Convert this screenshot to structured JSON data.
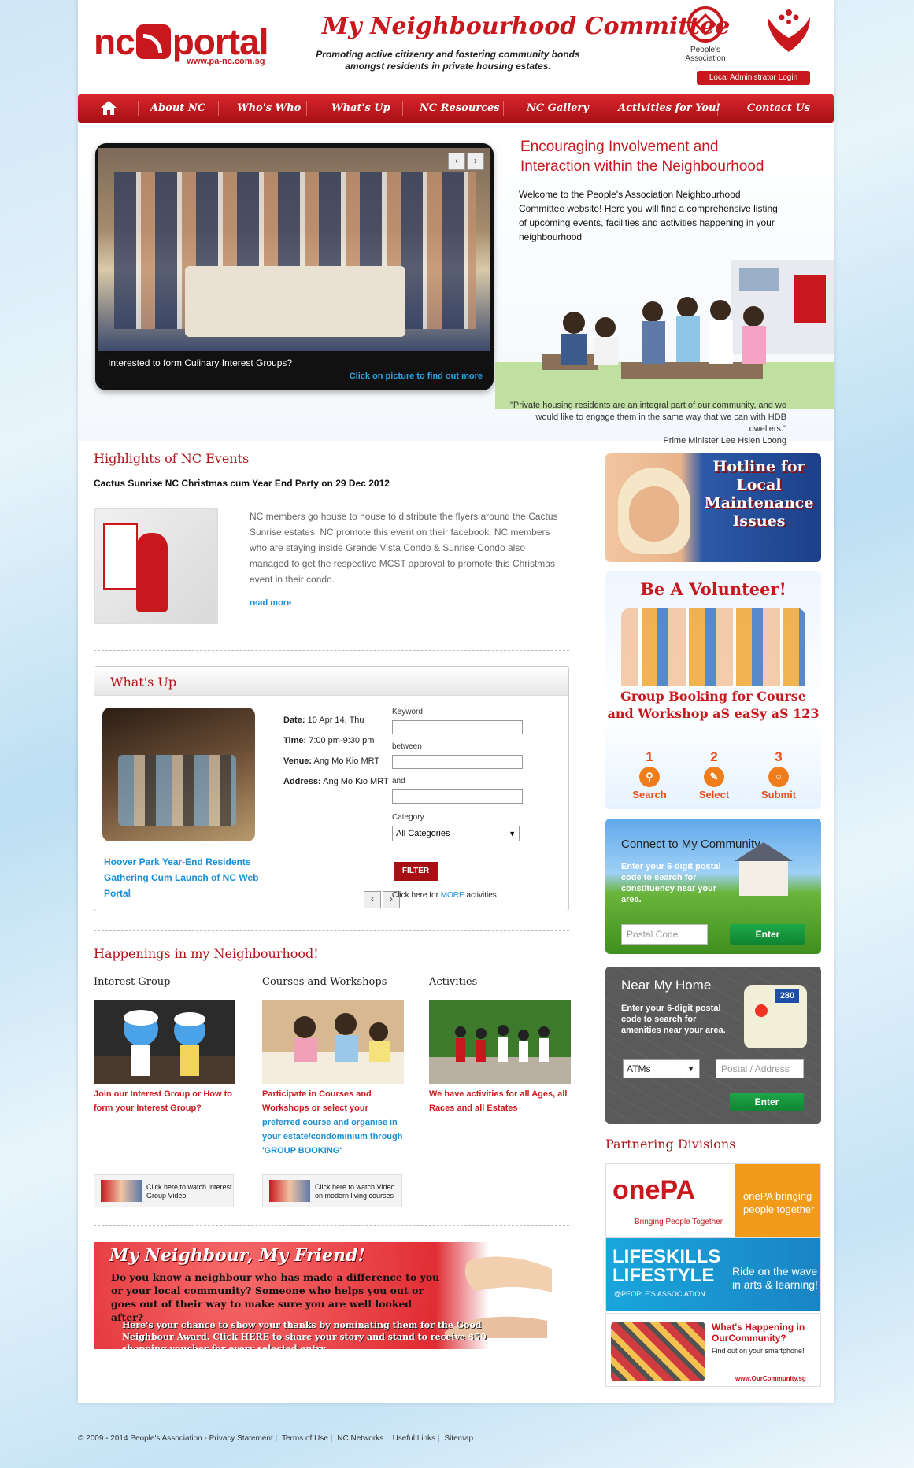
{
  "header": {
    "logo_nc": "nc",
    "logo_portal": "portal",
    "logo_url": "www.pa-nc.com.sg",
    "site_title": "My Neighbourhood Committee",
    "tagline": "Promoting active citizenry and fostering community bonds amongst residents in private housing estates.",
    "pa_label": "People's Association",
    "admin_login": "Local Administrator Login"
  },
  "nav": {
    "items": [
      "About NC",
      "Who's Who",
      "What's Up",
      "NC Resources",
      "NC Gallery",
      "Activities for You!",
      "Contact Us"
    ]
  },
  "hero": {
    "slider_caption": "Interested to form Culinary Interest Groups?",
    "slider_link": "Click on picture to find out more",
    "prev": "‹",
    "next": "›",
    "title_line1": "Encouraging Involvement and",
    "title_line2": "Interaction within the Neighbourhood",
    "intro": "Welcome to the People's Association Neighbourhood Committee website! Here you will find a comprehensive listing of upcoming events, facilities and activities happening in your neighbourhood",
    "quote": "\"Private housing residents are an integral part of our community, and we would like to engage them in the same way that we can with HDB dwellers.\"",
    "quote_author": "Prime Minister Lee Hsien Loong"
  },
  "highlights": {
    "title": "Highlights of NC Events",
    "event_title": "Cactus Sunrise NC Christmas cum Year End Party on 29 Dec 2012",
    "text": "NC members go house to house to distribute the flyers around the Cactus Sunrise estates. NC promote this event on their facebook. NC members who are staying inside Grande Vista Condo & Sunrise Condo also managed to get the respective MCST approval to promote this Christmas event in their condo.",
    "read_more": "read more"
  },
  "whats_up": {
    "title": "What's Up",
    "date_label": "Date:",
    "date": "10 Apr 14, Thu",
    "time_label": "Time:",
    "time": "7:00 pm-9:30 pm",
    "venue_label": "Venue:",
    "venue": "Ang Mo Kio MRT",
    "address_label": "Address:",
    "address": "Ang Mo Kio MRT",
    "event_link": "Hoover Park Year-End Residents Gathering Cum Launch of NC Web Portal",
    "keyword_label": "Keyword",
    "between_label": "between",
    "and_label": "and",
    "category_label": "Category",
    "category_value": "All Categories",
    "filter": "FILTER",
    "more_prefix": "Click here for ",
    "more_link": "MORE",
    "more_suffix": " activities"
  },
  "happenings": {
    "title": "Happenings in my Neighbourhood!",
    "interest_title": "Interest Group",
    "interest_text": "Join our Interest Group or How to form your Interest Group?",
    "courses_title": "Courses and Workshops",
    "courses_text_red": "Participate in Courses and Workshops or select your",
    "courses_text_blue": "preferred course and organise in your estate/condominium through 'GROUP BOOKING'",
    "activities_title": "Activities",
    "activities_text": "We have activities for all Ages, all Races and all Estates",
    "video1": "Click here to watch Interest Group Video",
    "video2": "Click here to watch Video on modern living courses"
  },
  "friend_banner": {
    "title": "My Neighbour, My Friend!",
    "question": "Do you know a neighbour who has made a difference to you or your local community? Someone who helps you out or goes out of their way to make sure you are well looked after?",
    "call": "Here's your chance to show your thanks by nominating them for the Good Neighbour Award. Click HERE to share your story and stand to receive $50 shopping voucher for every selected entry."
  },
  "sidebar": {
    "hotline": "Hotline for Local Maintenance Issues",
    "volunteer": "Be A Volunteer!",
    "group_booking": "Group Booking for Course and Workshop aS eaSy aS 123",
    "steps": [
      {
        "n": "1",
        "label": "Search"
      },
      {
        "n": "2",
        "label": "Select"
      },
      {
        "n": "3",
        "label": "Submit"
      }
    ],
    "connect_title": "Connect to My Community",
    "connect_text": "Enter your 6-digit postal code to search for constituency near your area.",
    "connect_placeholder": "Postal Code",
    "enter": "Enter",
    "near_title": "Near My Home",
    "near_text": "Enter your 6-digit postal code to search for amenities near your area.",
    "near_select": "ATMs",
    "near_placeholder": "Postal / Address",
    "near_shield": "280",
    "partner_title": "Partnering Divisions",
    "onepa_logo": "onePA",
    "onepa_sub": "Bringing People Together",
    "onepa_text": "onePA bringing people together",
    "lifeskills_logo": "LIFESKILLS LIFESTYLE",
    "lifeskills_sub": "@PEOPLE'S ASSOCIATION",
    "lifeskills_text": "Ride on the wave in arts & learning!",
    "ourcomm_title": "What's Happening in OurCommunity?",
    "ourcomm_text": "Find out on your smartphone!",
    "ourcomm_url": "www.OurCommunity.sg"
  },
  "footer": {
    "copyright": "© 2009 - 2014 People's Association - ",
    "links": [
      "Privacy Statement",
      "Terms of Use",
      "NC Networks",
      "Useful Links",
      "Sitemap"
    ]
  },
  "colors": {
    "brand_red": "#c8181e",
    "link_blue": "#1a8fd6"
  }
}
